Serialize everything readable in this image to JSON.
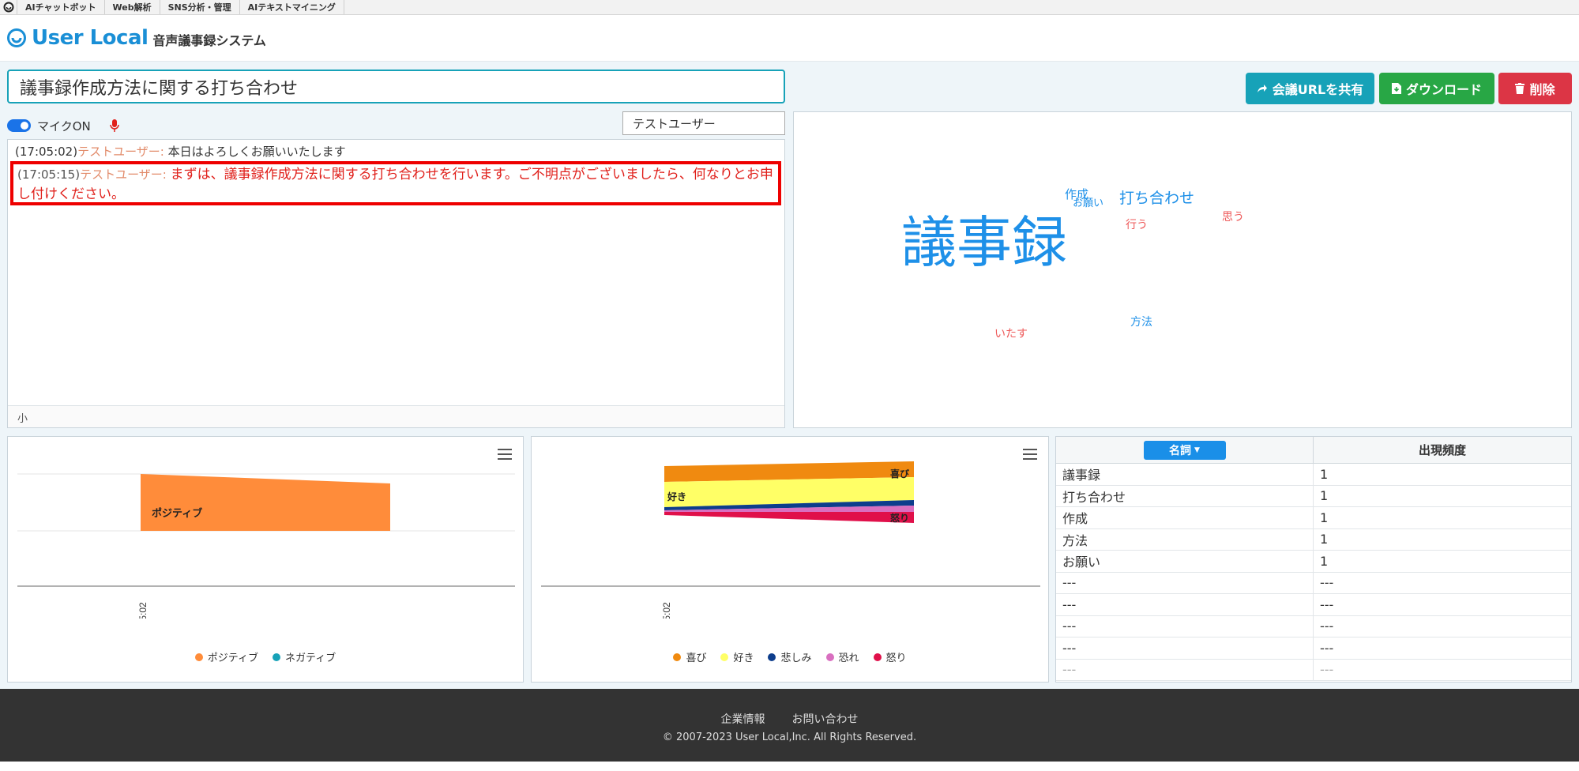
{
  "topbar": {
    "items": [
      "AIチャットボット",
      "Web解析",
      "SNS分析・管理",
      "AIテキストマイニング"
    ]
  },
  "header": {
    "brand": "User Local",
    "subtitle": "音声議事録システム"
  },
  "meeting": {
    "title": "議事録作成方法に関する打ち合わせ"
  },
  "actions": {
    "share_label": "会議URLを共有",
    "download_label": "ダウンロード",
    "delete_label": "削除"
  },
  "mic": {
    "label": "マイクON",
    "on": true
  },
  "speaker": {
    "selected": "テストユーザー"
  },
  "log": {
    "entries": [
      {
        "time": "(17:05:02)",
        "speaker": "テストユーザー: ",
        "text": "本日はよろしくお願いいたします"
      },
      {
        "time": "(17:05:15)",
        "speaker": "テストユーザー: ",
        "text": "まずは、議事録作成方法に関する打ち合わせを行います。ご不明点がございましたら、何なりとお申し付けください。"
      }
    ],
    "font_size_label": "小"
  },
  "wordcloud": {
    "words": [
      {
        "text": "議事録",
        "color": "#1e90e8"
      },
      {
        "text": "打ち合わせ",
        "color": "#1e90e8"
      },
      {
        "text": "作成",
        "color": "#1e90e8"
      },
      {
        "text": "お願い",
        "color": "#1e90e8"
      },
      {
        "text": "方法",
        "color": "#1e90e8"
      },
      {
        "text": "行う",
        "color": "#ee5a5a"
      },
      {
        "text": "思う",
        "color": "#ee5a5a"
      },
      {
        "text": "いたす",
        "color": "#ee5a5a"
      }
    ]
  },
  "chart_data": [
    {
      "type": "area",
      "x": [
        "17:05:02"
      ],
      "series": [
        {
          "name": "ポジティブ",
          "values": [
            1
          ],
          "color": "#ff8c3a"
        },
        {
          "name": "ネガティブ",
          "values": [
            0
          ],
          "color": "#17a2b8"
        }
      ],
      "inline_labels": [
        "ポジティブ"
      ]
    },
    {
      "type": "area",
      "x": [
        "17:05:02"
      ],
      "series": [
        {
          "name": "喜び",
          "color": "#f08a10"
        },
        {
          "name": "好き",
          "color": "#ffff66"
        },
        {
          "name": "悲しみ",
          "color": "#0d3d8c"
        },
        {
          "name": "恐れ",
          "color": "#d96fc0"
        },
        {
          "name": "怒り",
          "color": "#e0104a"
        }
      ],
      "inline_labels": [
        "喜び",
        "好き",
        "怒り"
      ]
    }
  ],
  "frequency": {
    "category_label": "名詞",
    "count_header": "出現頻度",
    "rows": [
      {
        "word": "議事録",
        "count": "1"
      },
      {
        "word": "打ち合わせ",
        "count": "1"
      },
      {
        "word": "作成",
        "count": "1"
      },
      {
        "word": "方法",
        "count": "1"
      },
      {
        "word": "お願い",
        "count": "1"
      },
      {
        "word": "---",
        "count": "---"
      },
      {
        "word": "---",
        "count": "---"
      },
      {
        "word": "---",
        "count": "---"
      },
      {
        "word": "---",
        "count": "---"
      },
      {
        "word": "---",
        "count": "---"
      }
    ]
  },
  "footer": {
    "company_label": "企業情報",
    "contact_label": "お問い合わせ",
    "copyright": "© 2007-2023 User Local,Inc. All Rights Reserved."
  }
}
